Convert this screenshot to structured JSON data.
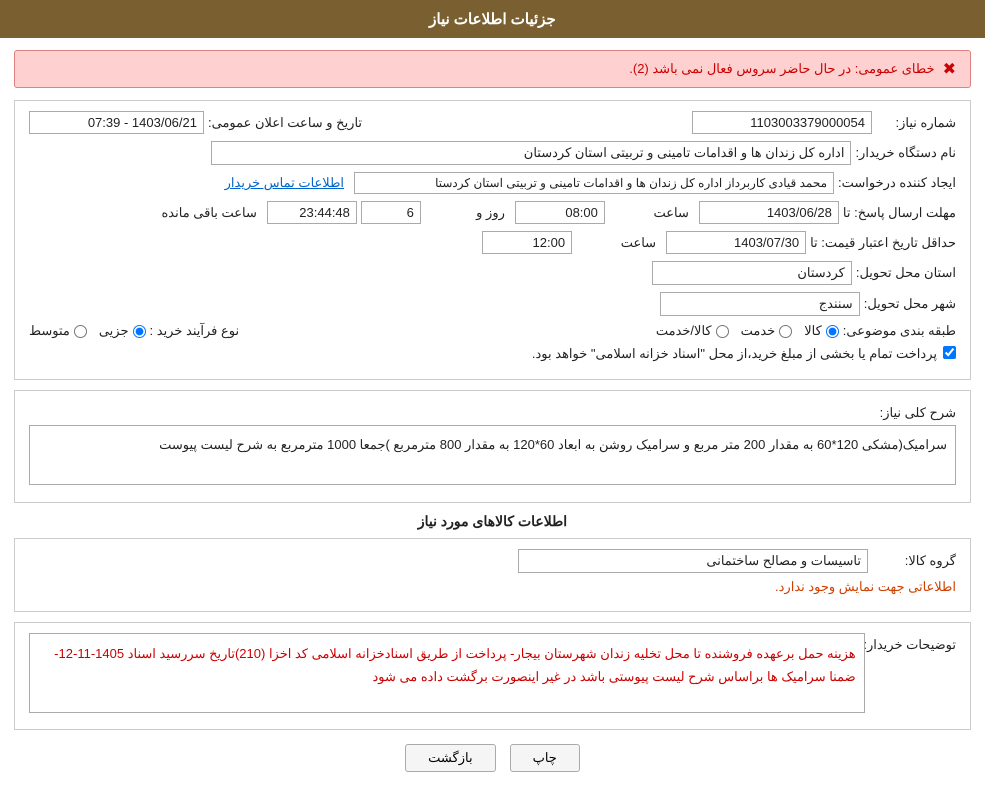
{
  "header": {
    "title": "جزئیات اطلاعات نیاز"
  },
  "error": {
    "icon": "✖",
    "message": "خطای عمومی: در حال حاضر سروس فعال نمی باشد (2)."
  },
  "form": {
    "shomareNiaz_label": "شماره نیاز:",
    "shomareNiaz_value": "1103003379000054",
    "namdastgah_label": "نام دستگاه خریدار:",
    "namdastgah_value": "اداره کل زندان ها و اقدامات تامینی و تربیتی استان کردستان",
    "ijadKonande_label": "ایجاد کننده درخواست:",
    "ijadKonande_value": "محمد  قیادی کاربرداز اداره کل زندان ها و اقدامات تامینی و تربیتی استان کردستا",
    "ijadKonande_link": "اطلاعات تماس خریدار",
    "tarikh_label": "تاریخ و ساعت اعلان عمومی:",
    "tarikh_value": "1403/06/21 - 07:39",
    "mohlat_label": "مهلت ارسال پاسخ: تا",
    "mohlat_date": "1403/06/28",
    "mohlat_time": "08:00",
    "mohlat_roz": "6",
    "mohlat_baghimande_label": "ساعت باقی مانده",
    "mohlat_countdown": "23:44:48",
    "hedaghal_label": "حداقل تاریخ اعتبار قیمت: تا",
    "hedaghal_date": "1403/07/30",
    "hedaghal_time": "12:00",
    "ostan_label": "استان محل تحویل:",
    "ostan_value": "کردستان",
    "shahr_label": "شهر محل تحویل:",
    "shahr_value": "سنندج",
    "tabaghe_label": "طبقه بندی موضوعی:",
    "tabaghe_options": [
      "کالا",
      "خدمت",
      "کالا/خدمت"
    ],
    "tabaghe_selected": "کالا",
    "noeFarayand_label": "نوع فرآیند خرید :",
    "noeFarayand_options": [
      "جزیی",
      "متوسط"
    ],
    "noeFarayand_selected": "جزیی",
    "pardakht_checkbox": true,
    "pardakht_text": "پرداخت تمام یا بخشی از مبلغ خرید،از محل \"اسناد خزانه اسلامی\" خواهد بود.",
    "sharh_label": "شرح کلی نیاز:",
    "sharh_value": "سرامیک(مشکی  120*60  به مقدار 200 متر مربع  و سرامیک روشن به ابعاد 60*120 به مقدار 800 مترمربع\n)جمعا 1000 مترمربع به شرح لیست پیوست",
    "kalainfo_title": "اطلاعات کالاهای مورد نیاز",
    "gorohKala_label": "گروه کالا:",
    "gorohKala_value": "تاسیسات و مصالح ساختمانی",
    "noinfo_text": "اطلاعاتی جهت نمایش وجود ندارد.",
    "tosaif_label": "توضیحات خریدار:",
    "tosaif_value": "هزینه حمل برعهده فروشنده  تا محل  تخلیه  زندان  شهرستان بیجار- پرداخت از طریق اسنادخزانه اسلامی کد اخزا  (210)تاریخ سررسید اسناد 1405-11-12- ضمنا سرامیک ها براساس شرح لیست پیوستی باشد در غیر اینصورت برگشت داده می شود",
    "btn_chap": "چاپ",
    "btn_bazgasht": "بازگشت"
  }
}
